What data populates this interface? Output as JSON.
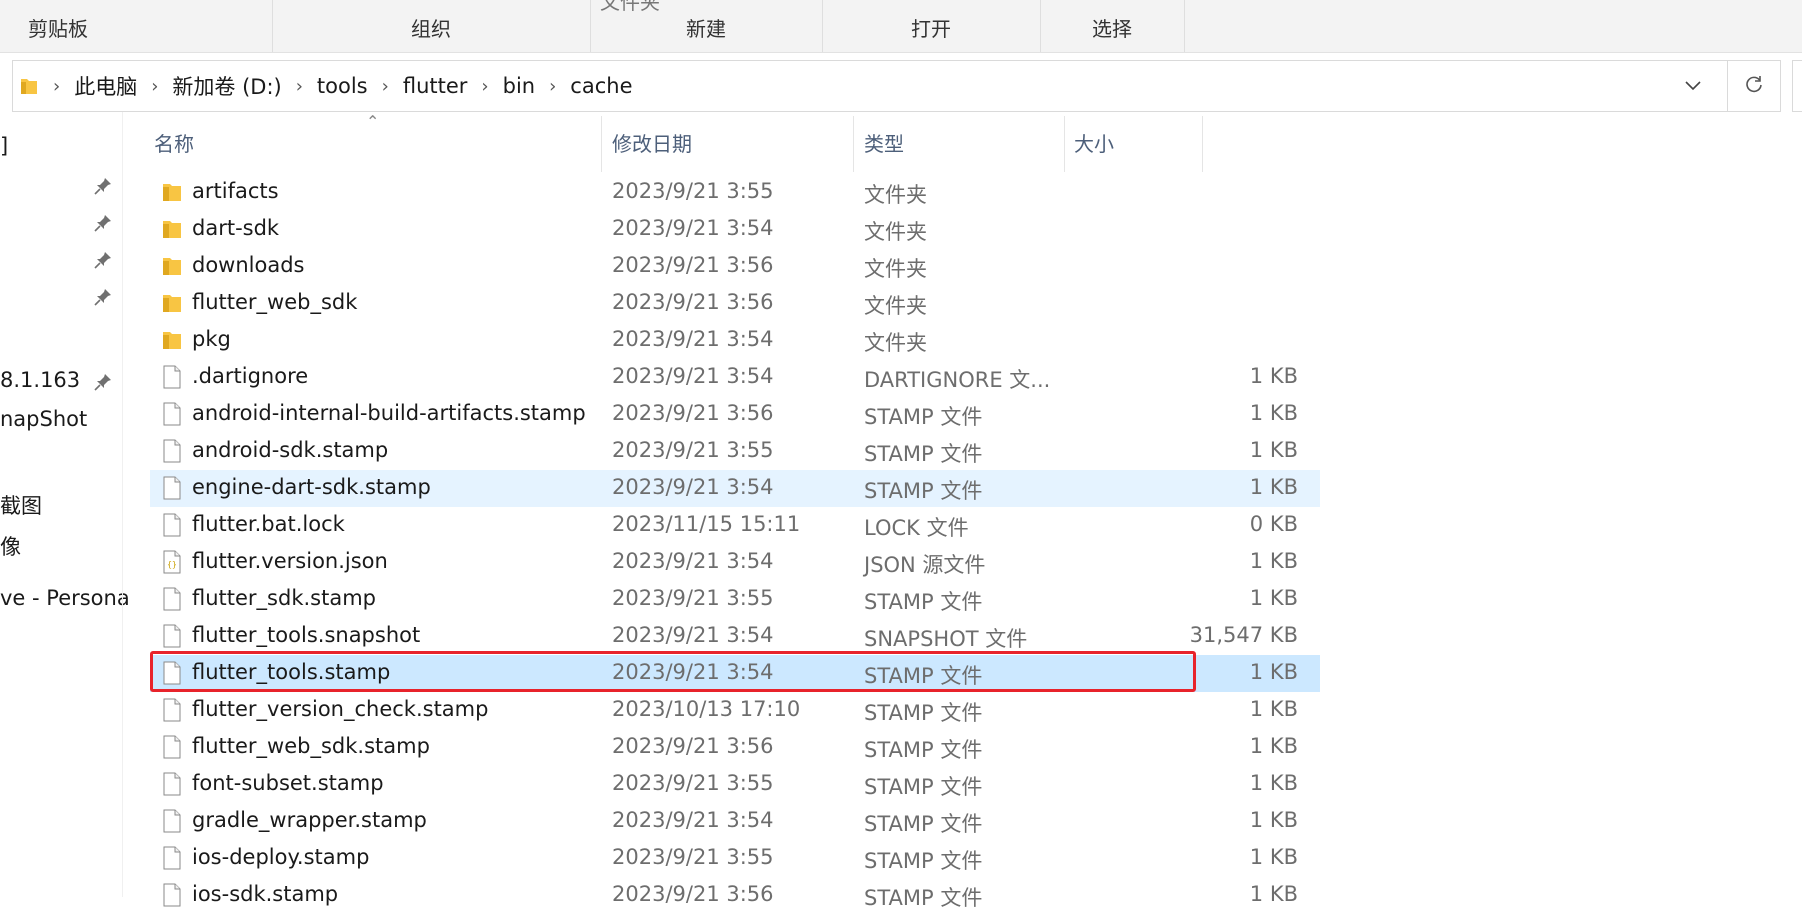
{
  "ribbon": {
    "groups": [
      {
        "label": "剪贴板",
        "partial": ""
      },
      {
        "label": "组织",
        "partial": ""
      },
      {
        "label": "新建",
        "partial": "文件夹"
      },
      {
        "label": "打开",
        "partial": ""
      },
      {
        "label": "选择",
        "partial": ""
      }
    ]
  },
  "address": {
    "crumbs": [
      "此电脑",
      "新加卷 (D:)",
      "tools",
      "flutter",
      "bin",
      "cache"
    ]
  },
  "nav": {
    "items": [
      {
        "label": "]",
        "pinned": false
      },
      {
        "label": "",
        "pinned": true
      },
      {
        "label": "",
        "pinned": true
      },
      {
        "label": "",
        "pinned": true
      },
      {
        "label": "",
        "pinned": true
      },
      {
        "label": "8.1.163",
        "pinned": true
      },
      {
        "label": "napShot",
        "pinned": false
      },
      {
        "label": "截图",
        "pinned": false
      },
      {
        "label": "像",
        "pinned": false
      },
      {
        "label": "ve - Persona",
        "pinned": false
      }
    ]
  },
  "columns": {
    "name": "名称",
    "date": "修改日期",
    "type": "类型",
    "size": "大小"
  },
  "files": [
    {
      "name": "artifacts",
      "date": "2023/9/21 3:55",
      "type": "文件夹",
      "size": "",
      "icon": "folder-icon",
      "state": ""
    },
    {
      "name": "dart-sdk",
      "date": "2023/9/21 3:54",
      "type": "文件夹",
      "size": "",
      "icon": "folder-icon",
      "state": ""
    },
    {
      "name": "downloads",
      "date": "2023/9/21 3:56",
      "type": "文件夹",
      "size": "",
      "icon": "folder-icon",
      "state": ""
    },
    {
      "name": "flutter_web_sdk",
      "date": "2023/9/21 3:56",
      "type": "文件夹",
      "size": "",
      "icon": "folder-icon",
      "state": ""
    },
    {
      "name": "pkg",
      "date": "2023/9/21 3:54",
      "type": "文件夹",
      "size": "",
      "icon": "folder-icon",
      "state": ""
    },
    {
      "name": ".dartignore",
      "date": "2023/9/21 3:54",
      "type": "DARTIGNORE 文...",
      "size": "1 KB",
      "icon": "file-icon",
      "state": ""
    },
    {
      "name": "android-internal-build-artifacts.stamp",
      "date": "2023/9/21 3:56",
      "type": "STAMP 文件",
      "size": "1 KB",
      "icon": "file-icon",
      "state": ""
    },
    {
      "name": "android-sdk.stamp",
      "date": "2023/9/21 3:55",
      "type": "STAMP 文件",
      "size": "1 KB",
      "icon": "file-icon",
      "state": ""
    },
    {
      "name": "engine-dart-sdk.stamp",
      "date": "2023/9/21 3:54",
      "type": "STAMP 文件",
      "size": "1 KB",
      "icon": "file-icon",
      "state": "hover"
    },
    {
      "name": "flutter.bat.lock",
      "date": "2023/11/15 15:11",
      "type": "LOCK 文件",
      "size": "0 KB",
      "icon": "file-icon",
      "state": ""
    },
    {
      "name": "flutter.version.json",
      "date": "2023/9/21 3:54",
      "type": "JSON 源文件",
      "size": "1 KB",
      "icon": "json-file-icon",
      "state": ""
    },
    {
      "name": "flutter_sdk.stamp",
      "date": "2023/9/21 3:55",
      "type": "STAMP 文件",
      "size": "1 KB",
      "icon": "file-icon",
      "state": ""
    },
    {
      "name": "flutter_tools.snapshot",
      "date": "2023/9/21 3:54",
      "type": "SNAPSHOT 文件",
      "size": "31,547 KB",
      "icon": "file-icon",
      "state": ""
    },
    {
      "name": "flutter_tools.stamp",
      "date": "2023/9/21 3:54",
      "type": "STAMP 文件",
      "size": "1 KB",
      "icon": "file-icon",
      "state": "selected"
    },
    {
      "name": "flutter_version_check.stamp",
      "date": "2023/10/13 17:10",
      "type": "STAMP 文件",
      "size": "1 KB",
      "icon": "file-icon",
      "state": ""
    },
    {
      "name": "flutter_web_sdk.stamp",
      "date": "2023/9/21 3:56",
      "type": "STAMP 文件",
      "size": "1 KB",
      "icon": "file-icon",
      "state": ""
    },
    {
      "name": "font-subset.stamp",
      "date": "2023/9/21 3:55",
      "type": "STAMP 文件",
      "size": "1 KB",
      "icon": "file-icon",
      "state": ""
    },
    {
      "name": "gradle_wrapper.stamp",
      "date": "2023/9/21 3:54",
      "type": "STAMP 文件",
      "size": "1 KB",
      "icon": "file-icon",
      "state": ""
    },
    {
      "name": "ios-deploy.stamp",
      "date": "2023/9/21 3:55",
      "type": "STAMP 文件",
      "size": "1 KB",
      "icon": "file-icon",
      "state": ""
    },
    {
      "name": "ios-sdk.stamp",
      "date": "2023/9/21 3:56",
      "type": "STAMP 文件",
      "size": "1 KB",
      "icon": "file-icon",
      "state": ""
    }
  ],
  "colors": {
    "selected_bg": "#cce8ff",
    "hover_bg": "#e5f3ff",
    "highlight_border": "#e8232b",
    "folder": "#f8c543"
  }
}
